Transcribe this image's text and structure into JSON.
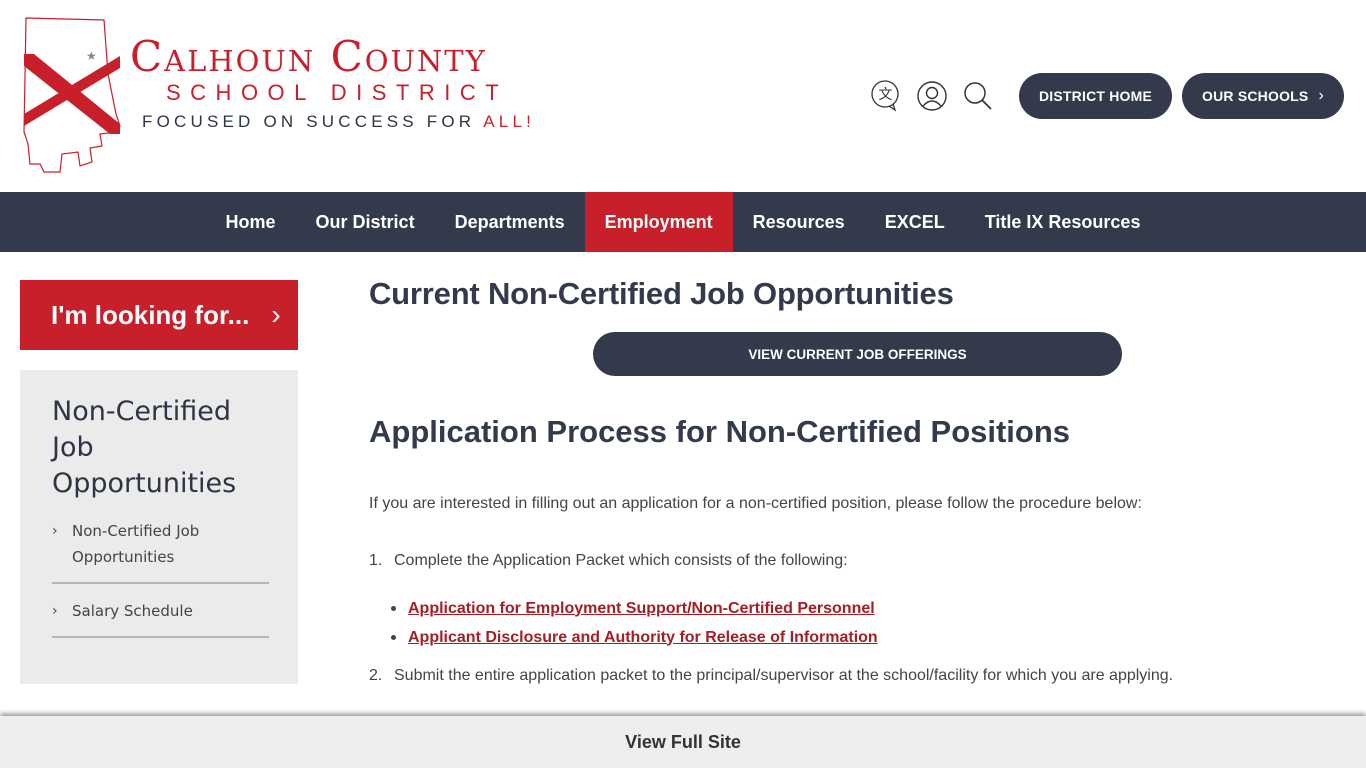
{
  "header": {
    "logo": {
      "title": "Calhoun County",
      "subtitle": "SCHOOL DISTRICT",
      "tagline_main": "FOCUSED ON SUCCESS FOR ",
      "tagline_accent": "ALL!"
    },
    "icons": [
      "translate-icon",
      "user-icon",
      "search-icon"
    ],
    "district_home_label": "DISTRICT HOME",
    "our_schools_label": "OUR SCHOOLS"
  },
  "nav": {
    "items": [
      {
        "label": "Home"
      },
      {
        "label": "Our District"
      },
      {
        "label": "Departments"
      },
      {
        "label": "Employment",
        "active": true
      },
      {
        "label": "Resources"
      },
      {
        "label": "EXCEL"
      },
      {
        "label": "Title IX Resources"
      }
    ]
  },
  "sidebar": {
    "looking_for_label": "I'm looking for...",
    "title": "Non-Certified Job Opportunities",
    "items": [
      {
        "label": "Non-Certified Job Opportunities"
      },
      {
        "label": "Salary Schedule"
      }
    ]
  },
  "main": {
    "title": "Current Non-Certified Job Opportunities",
    "cta_label": "VIEW CURRENT JOB OFFERINGS",
    "section_title": "Application Process for Non-Certified Positions",
    "intro": "If you are interested in filling out an application for a non-certified position, please follow the procedure below:",
    "steps": [
      {
        "num": "1.",
        "text": "Complete the Application Packet which consists of the following:"
      },
      {
        "num": "2.",
        "text": "Submit the entire application packet to the principal/supervisor at the school/facility for which you are applying."
      }
    ],
    "links": [
      {
        "label": "Application for Employment Support/Non-Certified Personnel"
      },
      {
        "label": "Applicant Disclosure and Authority for Release of Information"
      }
    ]
  },
  "footer": {
    "view_full_site_label": "View Full Site"
  },
  "colors": {
    "brand_red": "#c8202a",
    "navy": "#323a4c",
    "link_red": "#a51d25"
  }
}
